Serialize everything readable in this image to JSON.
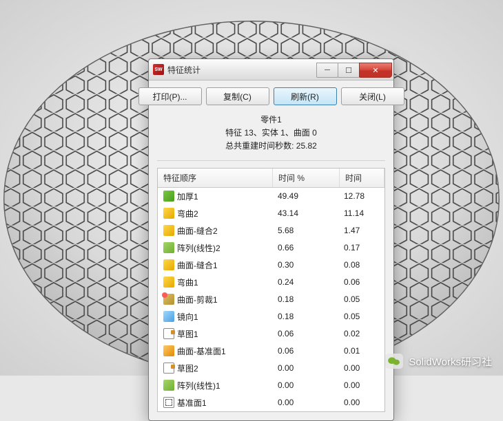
{
  "dialog": {
    "title": "特征统计",
    "buttons": {
      "print": "打印(P)...",
      "copy": "复制(C)",
      "refresh": "刷新(R)",
      "close": "关闭(L)"
    },
    "info": {
      "line1": "零件1",
      "line2": "特征 13、实体 1、曲面 0",
      "line3": "总共重建时间秒数: 25.82"
    },
    "columns": {
      "name": "特征顺序",
      "pct": "时间 %",
      "time": "时间"
    },
    "rows": [
      {
        "icon": "ico-green",
        "name": "加厚1",
        "pct": "49.49",
        "time": "12.78"
      },
      {
        "icon": "ico-yellow",
        "name": "弯曲2",
        "pct": "43.14",
        "time": "11.14"
      },
      {
        "icon": "ico-yellow",
        "name": "曲面-缝合2",
        "pct": "5.68",
        "time": "1.47"
      },
      {
        "icon": "ico-pattern",
        "name": "阵列(线性)2",
        "pct": "0.66",
        "time": "0.17"
      },
      {
        "icon": "ico-yellow",
        "name": "曲面-缝合1",
        "pct": "0.30",
        "time": "0.08"
      },
      {
        "icon": "ico-yellow",
        "name": "弯曲1",
        "pct": "0.24",
        "time": "0.06"
      },
      {
        "icon": "ico-trim",
        "name": "曲面-剪裁1",
        "pct": "0.18",
        "time": "0.05"
      },
      {
        "icon": "ico-mirror",
        "name": "镜向1",
        "pct": "0.18",
        "time": "0.05"
      },
      {
        "icon": "ico-sketch",
        "name": "草图1",
        "pct": "0.06",
        "time": "0.02"
      },
      {
        "icon": "ico-surf",
        "name": "曲面-基准面1",
        "pct": "0.06",
        "time": "0.01"
      },
      {
        "icon": "ico-sketch",
        "name": "草图2",
        "pct": "0.00",
        "time": "0.00"
      },
      {
        "icon": "ico-pattern",
        "name": "阵列(线性)1",
        "pct": "0.00",
        "time": "0.00"
      },
      {
        "icon": "ico-plane",
        "name": "基准面1",
        "pct": "0.00",
        "time": "0.00"
      }
    ]
  },
  "watermark": {
    "text": "SolidWorks研习社"
  }
}
